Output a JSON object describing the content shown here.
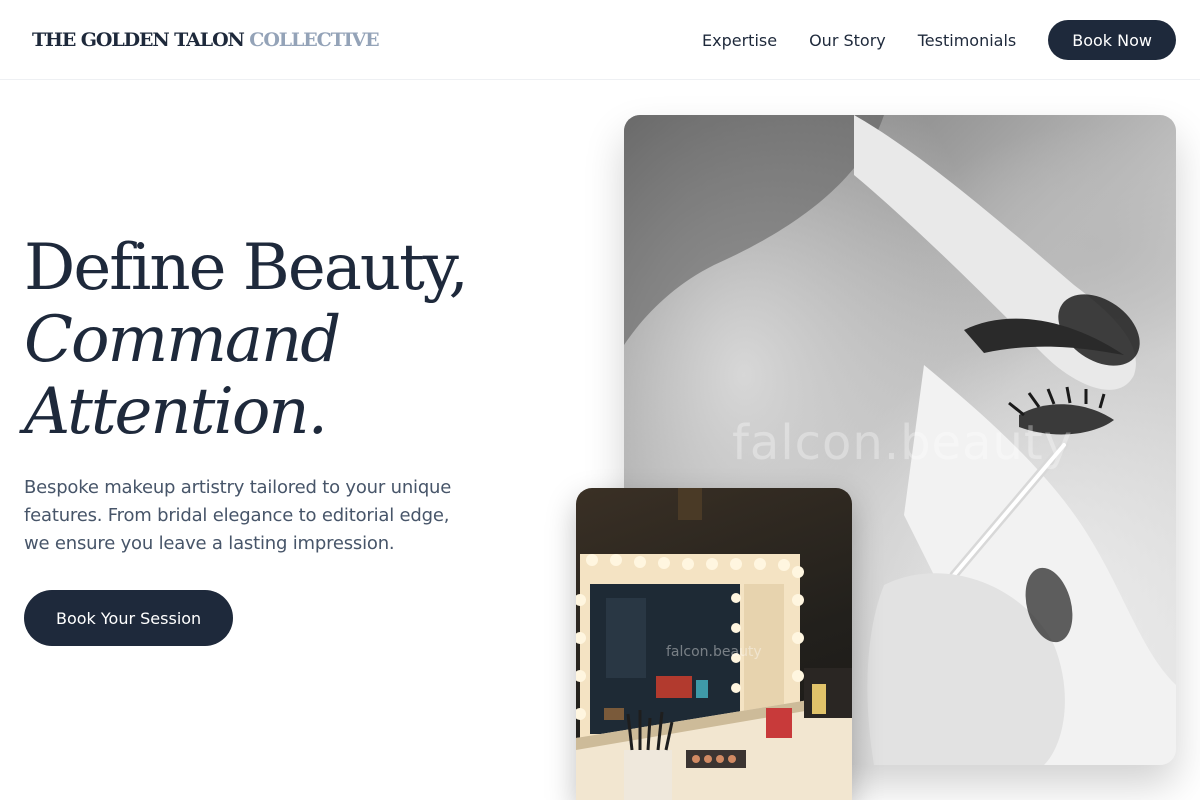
{
  "brand": {
    "name_main": "THE GOLDEN TALON",
    "name_sub": " COLLECTIVE"
  },
  "nav": {
    "links": [
      "Expertise",
      "Our Story",
      "Testimonials"
    ],
    "cta_label": "Book Now"
  },
  "hero": {
    "title_line1": "Define Beauty,",
    "title_line2": "Command",
    "title_line3": "Attention.",
    "subtitle": "Bespoke makeup artistry tailored to your unique features. From bridal elegance to editorial edge, we ensure you leave a lasting impression.",
    "cta_label": "Book Your Session"
  },
  "images": {
    "main_watermark": "falcon.beauty",
    "secondary_watermark": "falcon.beauty"
  },
  "colors": {
    "primary": "#1e293b",
    "muted": "#94a3b8",
    "body_text": "#475569",
    "background": "#ffffff"
  }
}
